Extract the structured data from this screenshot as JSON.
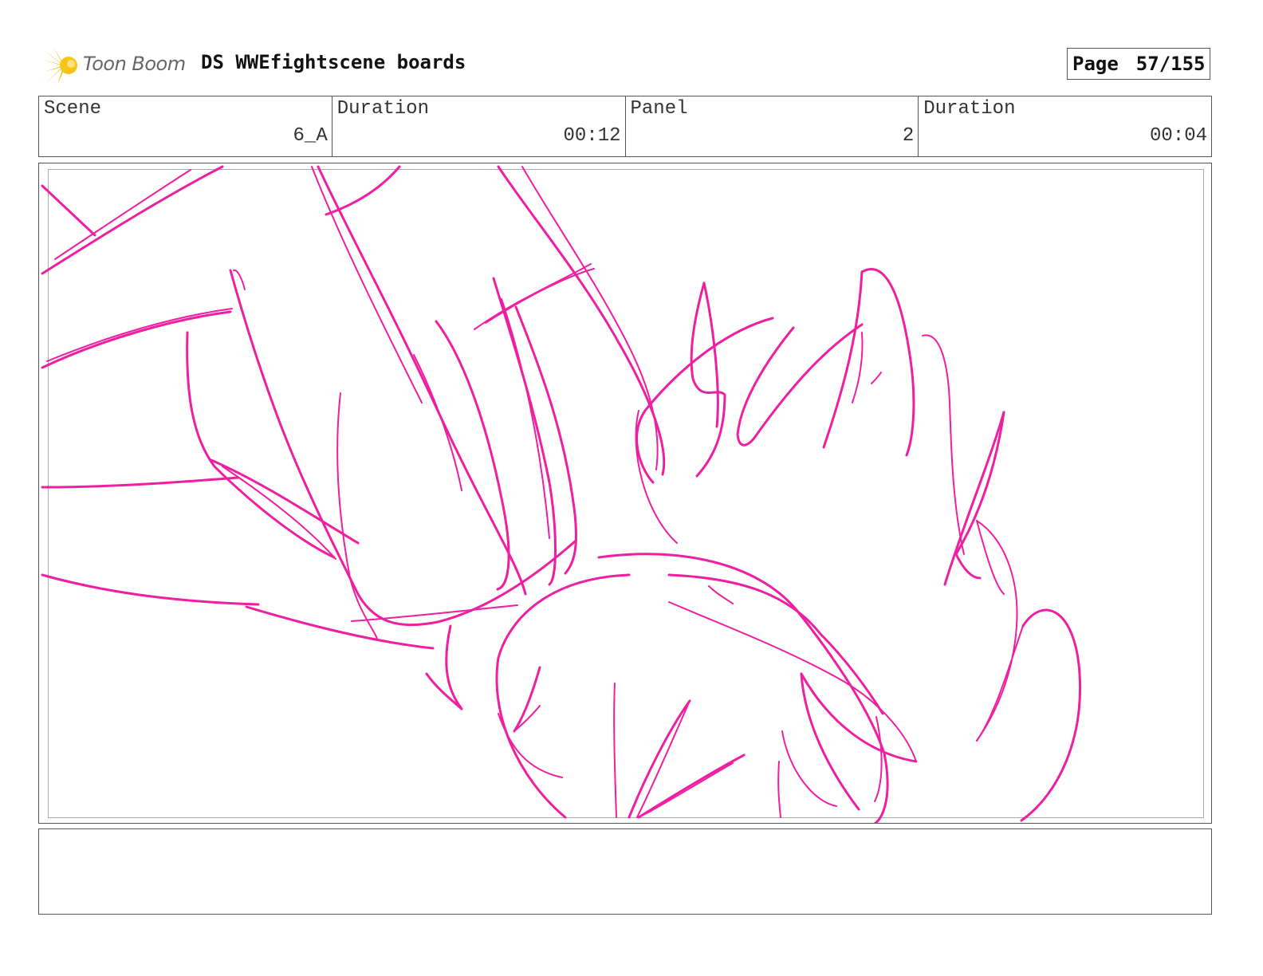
{
  "header": {
    "logo_text": "Toon Boom",
    "title": "DS WWEfightscene boards",
    "page_label": "Page",
    "page_value": "57/155"
  },
  "info": {
    "scene_label": "Scene",
    "scene_value": "6_A",
    "scene_duration_label": "Duration",
    "scene_duration_value": "00:12",
    "panel_label": "Panel",
    "panel_value": "2",
    "panel_duration_label": "Duration",
    "panel_duration_value": "00:04"
  },
  "colors": {
    "sketch": "#ee1fa0",
    "logo_burst": "#f5b800"
  },
  "icons": {
    "logo": "sunburst-icon"
  },
  "notes": {
    "text": ""
  }
}
